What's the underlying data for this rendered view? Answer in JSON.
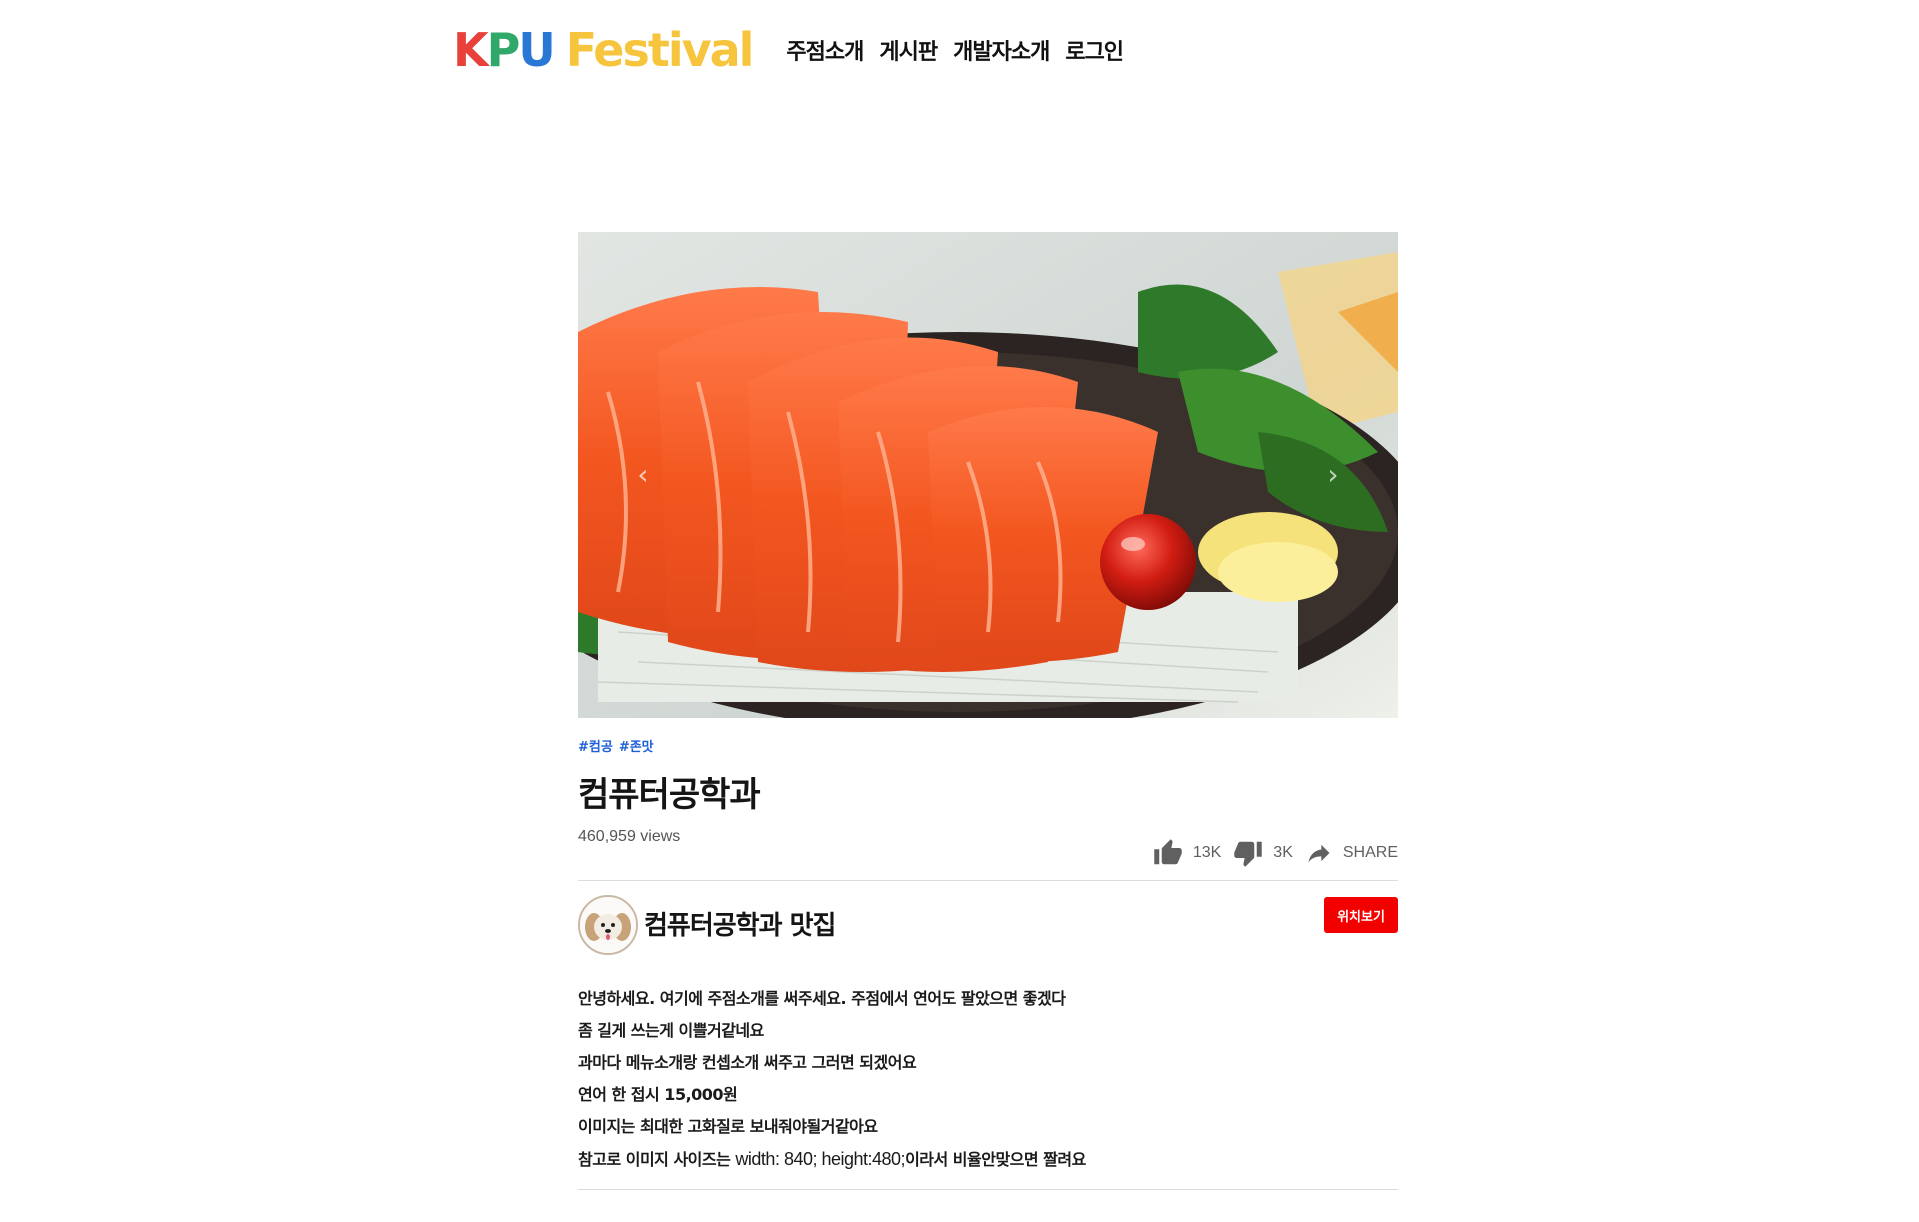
{
  "header": {
    "logo": {
      "k": "K",
      "p": "P",
      "u": "U",
      "festival": "Festival"
    },
    "nav": [
      {
        "label": "주점소개"
      },
      {
        "label": "게시판"
      },
      {
        "label": "개발자소개"
      },
      {
        "label": "로그인"
      }
    ]
  },
  "post": {
    "tags": [
      "#컴공",
      "#존맛"
    ],
    "title": "컴퓨터공학과",
    "views": "460,959 views",
    "likes": "13K",
    "dislikes": "3K",
    "share_label": "SHARE"
  },
  "channel": {
    "name": "컴퓨터공학과 맛집",
    "locate_button": "위치보기"
  },
  "description": {
    "lines": [
      "안녕하세요. 여기에 주점소개를 써주세요. 주점에서 연어도 팔았으면 좋겠다",
      "좀 길게 쓰는게 이쁠거같네요",
      "과마다 메뉴소개랑 컨셉소개 써주고 그러면 되겠어요",
      "연어 한 접시 15,000원",
      "이미지는 최대한 고화질로 보내줘야될거같아요"
    ],
    "last_line": {
      "prefix": "참고로 이미지 사이즈는 ",
      "code": "width: 840; height:480;",
      "suffix": "이라서 비율안맞으면 짤려요"
    }
  },
  "colors": {
    "accent_red": "#f20000",
    "tag_blue": "#1d5fd6"
  },
  "icons": {
    "like": "thumbs-up-icon",
    "dislike": "thumbs-down-icon",
    "share": "share-arrow-icon",
    "prev": "chevron-left-icon",
    "next": "chevron-right-icon"
  }
}
